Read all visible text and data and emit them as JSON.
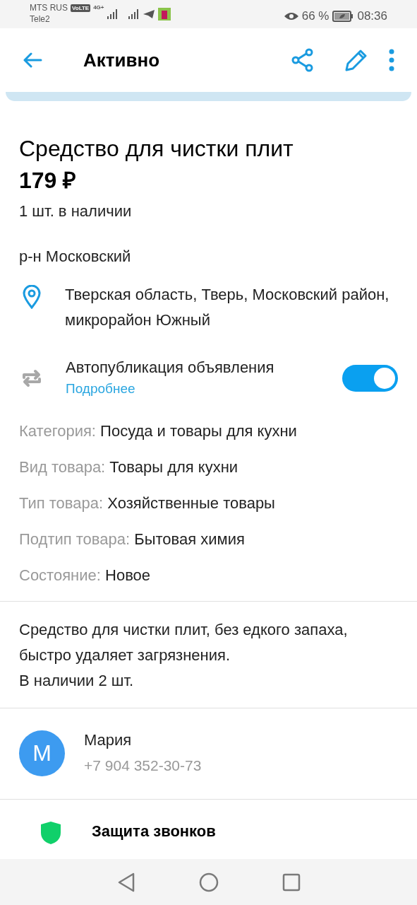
{
  "status_bar": {
    "carrier_1": "MTS RUS",
    "volte": "VoLTE",
    "network": "4G+",
    "carrier_2": "Tele2",
    "battery": "66 %",
    "time": "08:36"
  },
  "top_bar": {
    "title": "Активно"
  },
  "listing": {
    "title": "Средство для чистки плит",
    "price": "179 ₽",
    "stock": "1 шт. в наличии",
    "district": "р-н Московский",
    "address": "Тверская область, Тверь, Московский район, микрорайон Южный"
  },
  "autopublish": {
    "label": "Автопубликация объявления",
    "link": "Подробнее",
    "on": true
  },
  "attributes": [
    {
      "name": "Категория:",
      "value": "Посуда и товары для кухни"
    },
    {
      "name": "Вид товара:",
      "value": "Товары для кухни"
    },
    {
      "name": "Тип товара:",
      "value": "Хозяйственные товары"
    },
    {
      "name": "Подтип товара:",
      "value": "Бытовая химия"
    },
    {
      "name": "Состояние:",
      "value": "Новое"
    }
  ],
  "description": "Средство для чистки плит, без едкого запаха, быстро удаляет загрязнения.\nВ наличии 2 шт.",
  "seller": {
    "initial": "М",
    "name": "Мария",
    "phone": "+7 904 352-30-73"
  },
  "call_protection": {
    "title": "Защита звонков"
  }
}
